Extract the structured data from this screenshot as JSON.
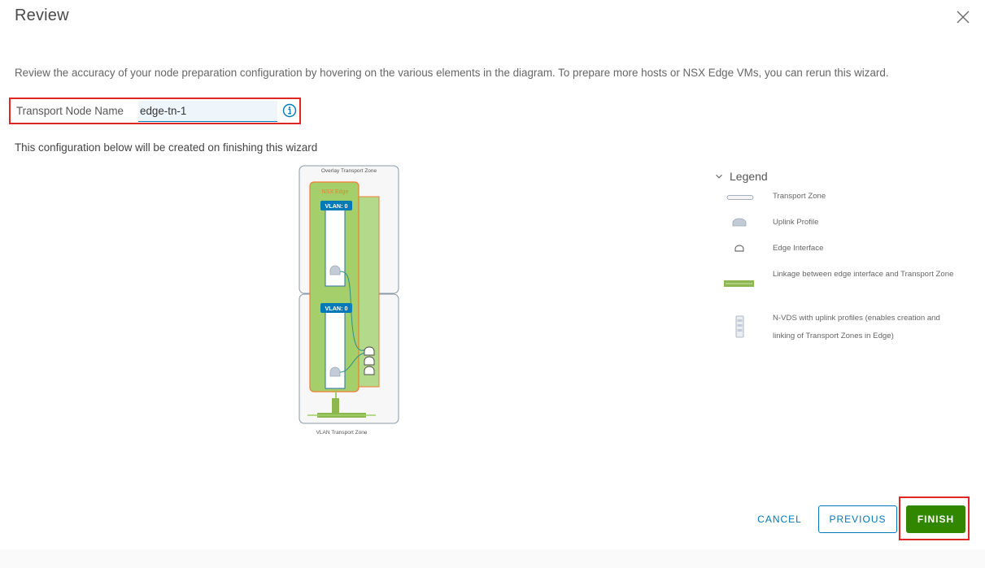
{
  "dialog": {
    "title": "Review",
    "close_icon": "close-icon",
    "description": "Review the accuracy of your node preparation configuration by hovering on the various elements in the diagram. To prepare more hosts or NSX Edge VMs, you can rerun this wizard.",
    "transport_node": {
      "label": "Transport Node Name",
      "value": "edge-tn-1",
      "info_icon": "info-icon"
    },
    "config_text": "This configuration below will be created on finishing this wizard"
  },
  "diagram": {
    "overlay_zone_label": "Overlay Transport Zone",
    "nsx_edge_label": "NSX Edge",
    "vlan_badge_1": "VLAN: 0",
    "vlan_badge_2": "VLAN: 0",
    "vlan_zone_label": "VLAN Transport Zone"
  },
  "legend": {
    "title": "Legend",
    "items": [
      {
        "icon": "transport-zone-icon",
        "label": "Transport Zone"
      },
      {
        "icon": "uplink-profile-icon",
        "label": "Uplink Profile"
      },
      {
        "icon": "edge-interface-icon",
        "label": "Edge Interface"
      },
      {
        "icon": "linkage-icon",
        "label": "Linkage between edge interface and Transport Zone"
      },
      {
        "icon": "nvds-icon",
        "label": "N-VDS with uplink profiles (enables creation and linking of Transport Zones in Edge)"
      }
    ]
  },
  "footer": {
    "cancel": "CANCEL",
    "previous": "PREVIOUS",
    "finish": "FINISH"
  },
  "colors": {
    "primary": "#0079b8",
    "success": "#318700",
    "highlight": "#e12626",
    "edge_green": "#a4cf6a",
    "edge_orange": "#f47a33"
  }
}
